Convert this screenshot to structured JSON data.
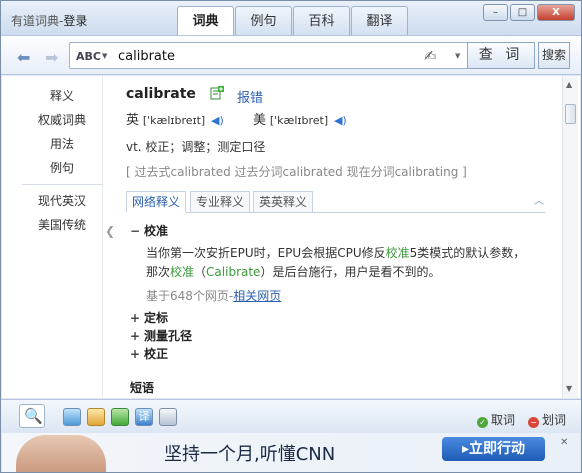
{
  "window": {
    "app_name": "有道词典",
    "login": "登录",
    "controls": [
      "–",
      "□",
      "X"
    ]
  },
  "tabs": [
    {
      "label": "词典",
      "active": true
    },
    {
      "label": "例句",
      "active": false
    },
    {
      "label": "百科",
      "active": false
    },
    {
      "label": "翻译",
      "active": false
    }
  ],
  "search": {
    "mode": "ABC",
    "query": "calibrate",
    "query_button": "查 词",
    "search_button": "搜索"
  },
  "sidebar": {
    "items": [
      "释义",
      "权威词典",
      "用法",
      "例句"
    ],
    "items2": [
      "现代英汉",
      "美国传统"
    ]
  },
  "entry": {
    "word": "calibrate",
    "report": "报错",
    "uk_label": "英",
    "uk_ipa": "['kælɪbreɪt]",
    "us_label": "美",
    "us_ipa": "['kælɪbret]",
    "definition": "vt. 校正；调整；测定口径",
    "forms": "[ 过去式calibrated 过去分词calibrated 现在分词calibrating ]"
  },
  "subtabs": [
    {
      "label": "网络释义",
      "active": true
    },
    {
      "label": "专业释义",
      "active": false
    },
    {
      "label": "英英释义",
      "active": false
    }
  ],
  "senses": {
    "main": {
      "sign": "−",
      "label": "校准"
    },
    "example_line1_a": "当你第一次安折EPU时，EPU会根据CPU修反",
    "example_line1_hl": "校准",
    "example_line1_b": "5类模式的默认参数，",
    "example_line2_a": "那次",
    "example_line2_hl": "校准",
    "example_line2_b": "（",
    "example_line2_hl2": "Calibrate",
    "example_line2_c": "）是后台施行，用户是看不到的。",
    "source": "基于648个网页-",
    "source_link": "相关网页",
    "others": [
      {
        "sign": "+",
        "label": "定标"
      },
      {
        "sign": "+",
        "label": "测量孔径"
      },
      {
        "sign": "+",
        "label": "校正"
      }
    ],
    "phrase_heading": "短语"
  },
  "toolbar": {
    "pick_word": "取词",
    "select_word": "划词"
  },
  "ad": {
    "text": "坚持一个月,听懂CNN",
    "button": "▸立即行动"
  }
}
